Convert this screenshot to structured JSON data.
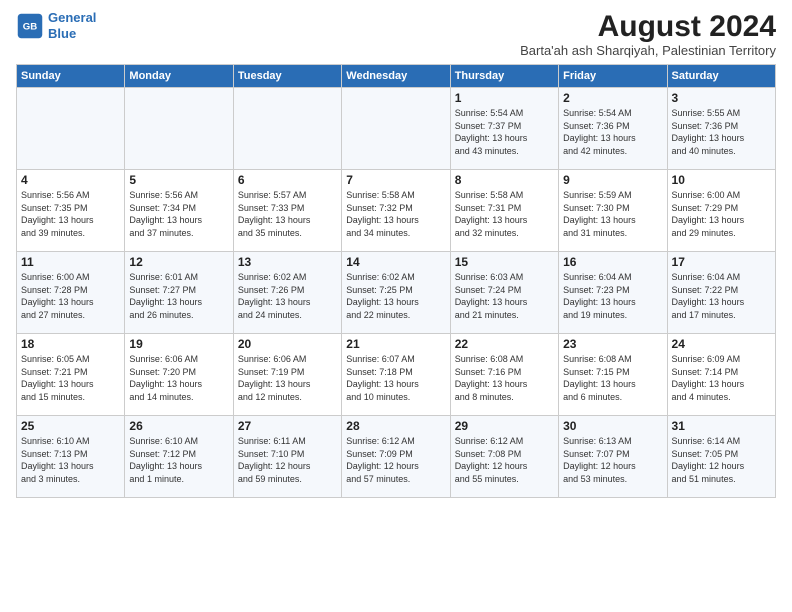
{
  "header": {
    "logo_line1": "General",
    "logo_line2": "Blue",
    "main_title": "August 2024",
    "subtitle": "Barta'ah ash Sharqiyah, Palestinian Territory"
  },
  "days_of_week": [
    "Sunday",
    "Monday",
    "Tuesday",
    "Wednesday",
    "Thursday",
    "Friday",
    "Saturday"
  ],
  "weeks": [
    [
      {
        "day": "",
        "info": ""
      },
      {
        "day": "",
        "info": ""
      },
      {
        "day": "",
        "info": ""
      },
      {
        "day": "",
        "info": ""
      },
      {
        "day": "1",
        "info": "Sunrise: 5:54 AM\nSunset: 7:37 PM\nDaylight: 13 hours\nand 43 minutes."
      },
      {
        "day": "2",
        "info": "Sunrise: 5:54 AM\nSunset: 7:36 PM\nDaylight: 13 hours\nand 42 minutes."
      },
      {
        "day": "3",
        "info": "Sunrise: 5:55 AM\nSunset: 7:36 PM\nDaylight: 13 hours\nand 40 minutes."
      }
    ],
    [
      {
        "day": "4",
        "info": "Sunrise: 5:56 AM\nSunset: 7:35 PM\nDaylight: 13 hours\nand 39 minutes."
      },
      {
        "day": "5",
        "info": "Sunrise: 5:56 AM\nSunset: 7:34 PM\nDaylight: 13 hours\nand 37 minutes."
      },
      {
        "day": "6",
        "info": "Sunrise: 5:57 AM\nSunset: 7:33 PM\nDaylight: 13 hours\nand 35 minutes."
      },
      {
        "day": "7",
        "info": "Sunrise: 5:58 AM\nSunset: 7:32 PM\nDaylight: 13 hours\nand 34 minutes."
      },
      {
        "day": "8",
        "info": "Sunrise: 5:58 AM\nSunset: 7:31 PM\nDaylight: 13 hours\nand 32 minutes."
      },
      {
        "day": "9",
        "info": "Sunrise: 5:59 AM\nSunset: 7:30 PM\nDaylight: 13 hours\nand 31 minutes."
      },
      {
        "day": "10",
        "info": "Sunrise: 6:00 AM\nSunset: 7:29 PM\nDaylight: 13 hours\nand 29 minutes."
      }
    ],
    [
      {
        "day": "11",
        "info": "Sunrise: 6:00 AM\nSunset: 7:28 PM\nDaylight: 13 hours\nand 27 minutes."
      },
      {
        "day": "12",
        "info": "Sunrise: 6:01 AM\nSunset: 7:27 PM\nDaylight: 13 hours\nand 26 minutes."
      },
      {
        "day": "13",
        "info": "Sunrise: 6:02 AM\nSunset: 7:26 PM\nDaylight: 13 hours\nand 24 minutes."
      },
      {
        "day": "14",
        "info": "Sunrise: 6:02 AM\nSunset: 7:25 PM\nDaylight: 13 hours\nand 22 minutes."
      },
      {
        "day": "15",
        "info": "Sunrise: 6:03 AM\nSunset: 7:24 PM\nDaylight: 13 hours\nand 21 minutes."
      },
      {
        "day": "16",
        "info": "Sunrise: 6:04 AM\nSunset: 7:23 PM\nDaylight: 13 hours\nand 19 minutes."
      },
      {
        "day": "17",
        "info": "Sunrise: 6:04 AM\nSunset: 7:22 PM\nDaylight: 13 hours\nand 17 minutes."
      }
    ],
    [
      {
        "day": "18",
        "info": "Sunrise: 6:05 AM\nSunset: 7:21 PM\nDaylight: 13 hours\nand 15 minutes."
      },
      {
        "day": "19",
        "info": "Sunrise: 6:06 AM\nSunset: 7:20 PM\nDaylight: 13 hours\nand 14 minutes."
      },
      {
        "day": "20",
        "info": "Sunrise: 6:06 AM\nSunset: 7:19 PM\nDaylight: 13 hours\nand 12 minutes."
      },
      {
        "day": "21",
        "info": "Sunrise: 6:07 AM\nSunset: 7:18 PM\nDaylight: 13 hours\nand 10 minutes."
      },
      {
        "day": "22",
        "info": "Sunrise: 6:08 AM\nSunset: 7:16 PM\nDaylight: 13 hours\nand 8 minutes."
      },
      {
        "day": "23",
        "info": "Sunrise: 6:08 AM\nSunset: 7:15 PM\nDaylight: 13 hours\nand 6 minutes."
      },
      {
        "day": "24",
        "info": "Sunrise: 6:09 AM\nSunset: 7:14 PM\nDaylight: 13 hours\nand 4 minutes."
      }
    ],
    [
      {
        "day": "25",
        "info": "Sunrise: 6:10 AM\nSunset: 7:13 PM\nDaylight: 13 hours\nand 3 minutes."
      },
      {
        "day": "26",
        "info": "Sunrise: 6:10 AM\nSunset: 7:12 PM\nDaylight: 13 hours\nand 1 minute."
      },
      {
        "day": "27",
        "info": "Sunrise: 6:11 AM\nSunset: 7:10 PM\nDaylight: 12 hours\nand 59 minutes."
      },
      {
        "day": "28",
        "info": "Sunrise: 6:12 AM\nSunset: 7:09 PM\nDaylight: 12 hours\nand 57 minutes."
      },
      {
        "day": "29",
        "info": "Sunrise: 6:12 AM\nSunset: 7:08 PM\nDaylight: 12 hours\nand 55 minutes."
      },
      {
        "day": "30",
        "info": "Sunrise: 6:13 AM\nSunset: 7:07 PM\nDaylight: 12 hours\nand 53 minutes."
      },
      {
        "day": "31",
        "info": "Sunrise: 6:14 AM\nSunset: 7:05 PM\nDaylight: 12 hours\nand 51 minutes."
      }
    ]
  ]
}
